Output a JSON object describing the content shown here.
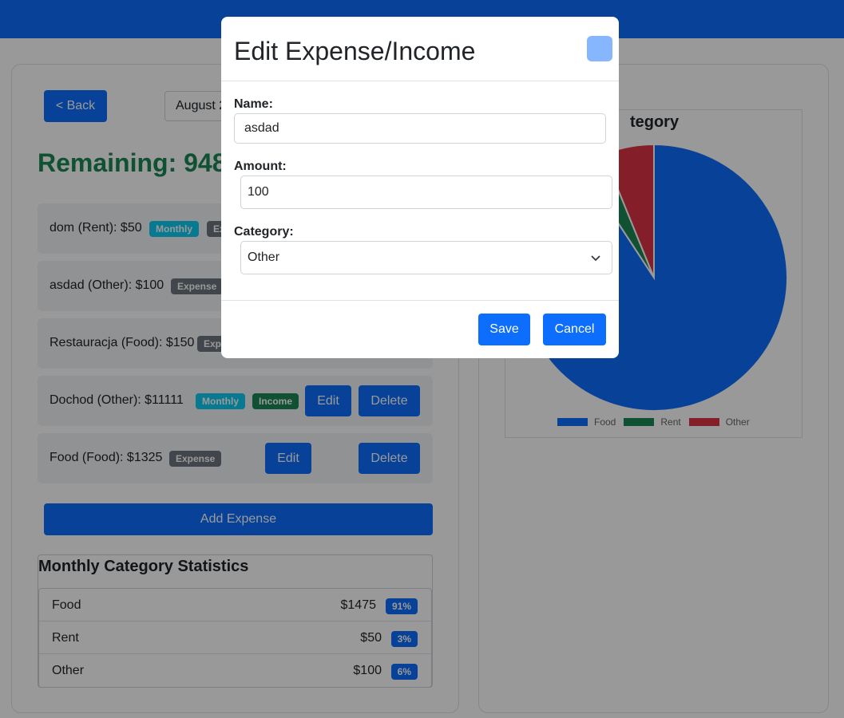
{
  "colors": {
    "primary": "#0d6efd",
    "success": "#198754",
    "info": "#0dcaf0",
    "secondary": "#6c757d",
    "danger": "#dc3545"
  },
  "header": {
    "back_label": "< Back",
    "month_label": "August 2"
  },
  "remaining_label": "Remaining: 948",
  "entries": [
    {
      "text": "dom (Rent): $50",
      "badges": [
        "Monthly",
        "Ex"
      ]
    },
    {
      "text": "asdad (Other): $100",
      "badges": [
        "Expense"
      ]
    },
    {
      "text": "Restauracja (Food): $150",
      "badges": [
        "Exp"
      ]
    },
    {
      "text": "Dochod (Other): $11111",
      "badges": [
        "Monthly",
        "Income"
      ],
      "edit_label": "Edit",
      "delete_label": "Delete"
    },
    {
      "text": "Food (Food): $1325",
      "badges": [
        "Expense"
      ],
      "edit_label": "Edit",
      "delete_label": "Delete"
    }
  ],
  "add_expense_label": "Add Expense",
  "stats": {
    "title": "Monthly Category Statistics",
    "rows": [
      {
        "name": "Food",
        "amount": "$1475",
        "pct": "91%"
      },
      {
        "name": "Rent",
        "amount": "$50",
        "pct": "3%"
      },
      {
        "name": "Other",
        "amount": "$100",
        "pct": "6%"
      }
    ]
  },
  "chart_title": "tegory",
  "chart_data": {
    "type": "pie",
    "categories": [
      "Food",
      "Rent",
      "Other"
    ],
    "values": [
      1475,
      50,
      100
    ],
    "colors": [
      "#0d6efd",
      "#198754",
      "#dc3545"
    ],
    "legend": "bottom"
  },
  "modal": {
    "title": "Edit Expense/Income",
    "name_label": "Name:",
    "name_value": "asdad",
    "amount_label": "Amount:",
    "amount_value": "100",
    "category_label": "Category:",
    "category_value": "Other",
    "save_label": "Save",
    "cancel_label": "Cancel"
  }
}
